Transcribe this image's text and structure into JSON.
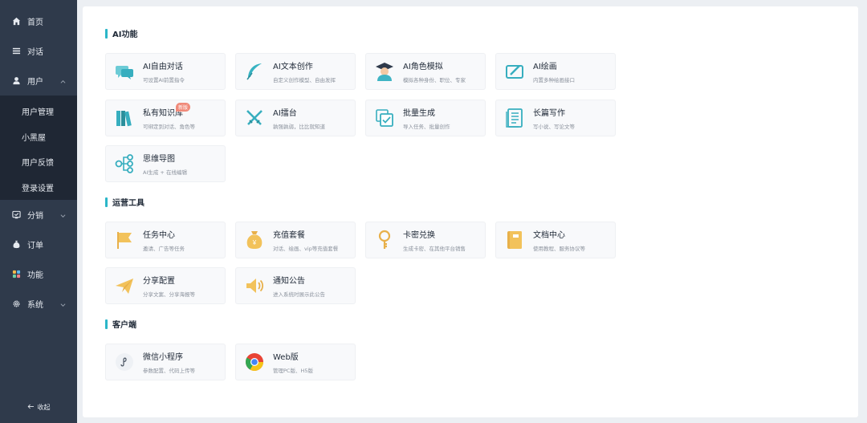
{
  "colors": {
    "sidebar_bg": "#2f3a4b",
    "submenu_bg": "#1f2734",
    "accent": "#2bb6c8",
    "badge": "#f08a7a"
  },
  "sidebar": {
    "items": [
      {
        "label": "首页",
        "icon": "home-icon"
      },
      {
        "label": "对话",
        "icon": "menu-lines-icon"
      },
      {
        "label": "用户",
        "icon": "user-icon",
        "expanded": true
      }
    ],
    "user_sub": [
      "用户管理",
      "小黑屋",
      "用户反馈",
      "登录设置"
    ],
    "items_after": [
      {
        "label": "分销",
        "icon": "share-icon"
      },
      {
        "label": "订单",
        "icon": "money-bag-icon"
      },
      {
        "label": "功能",
        "icon": "grid-icon"
      },
      {
        "label": "系统",
        "icon": "gear-icon"
      }
    ],
    "collapse_label": "收起"
  },
  "sections": [
    {
      "title": "AI功能",
      "cards": [
        {
          "title": "AI自由对话",
          "desc": "可设置AI前置指令",
          "icon": "chat-bubble-icon"
        },
        {
          "title": "AI文本创作",
          "desc": "自定义创作模型、自由发挥",
          "icon": "feather-pen-icon"
        },
        {
          "title": "AI角色模拟",
          "desc": "模拟各种身份、职位、专家",
          "icon": "graduate-icon"
        },
        {
          "title": "AI绘画",
          "desc": "内置多种绘画接口",
          "icon": "paint-board-icon"
        },
        {
          "title": "私有知识库",
          "desc": "可绑定到对话、角色等",
          "icon": "books-icon",
          "badge": "新版"
        },
        {
          "title": "AI擂台",
          "desc": "孰强孰弱，比比就知道",
          "icon": "crossed-swords-icon"
        },
        {
          "title": "批量生成",
          "desc": "导入任务、批量创作",
          "icon": "batch-check-icon"
        },
        {
          "title": "长篇写作",
          "desc": "写小说、写论文等",
          "icon": "document-list-icon"
        },
        {
          "title": "思维导图",
          "desc": "AI生成 + 在线编辑",
          "icon": "mindmap-icon"
        }
      ]
    },
    {
      "title": "运营工具",
      "cards": [
        {
          "title": "任务中心",
          "desc": "邀请、广告等任务",
          "icon": "flag-icon"
        },
        {
          "title": "充值套餐",
          "desc": "对话、绘画、vip等充值套餐",
          "icon": "money-bag-icon"
        },
        {
          "title": "卡密兑换",
          "desc": "生成卡密、在其他平台销售",
          "icon": "key-icon"
        },
        {
          "title": "文档中心",
          "desc": "使用教程、服务协议等",
          "icon": "book-icon"
        },
        {
          "title": "分享配置",
          "desc": "分享文案、分享海报等",
          "icon": "paper-plane-icon"
        },
        {
          "title": "通知公告",
          "desc": "进入系统时展示此公告",
          "icon": "speaker-icon"
        }
      ]
    },
    {
      "title": "客户端",
      "cards": [
        {
          "title": "微信小程序",
          "desc": "参数配置、代码上传等",
          "icon": "mini-program-icon"
        },
        {
          "title": "Web版",
          "desc": "管理PC版、H5版",
          "icon": "chrome-icon"
        }
      ]
    }
  ]
}
